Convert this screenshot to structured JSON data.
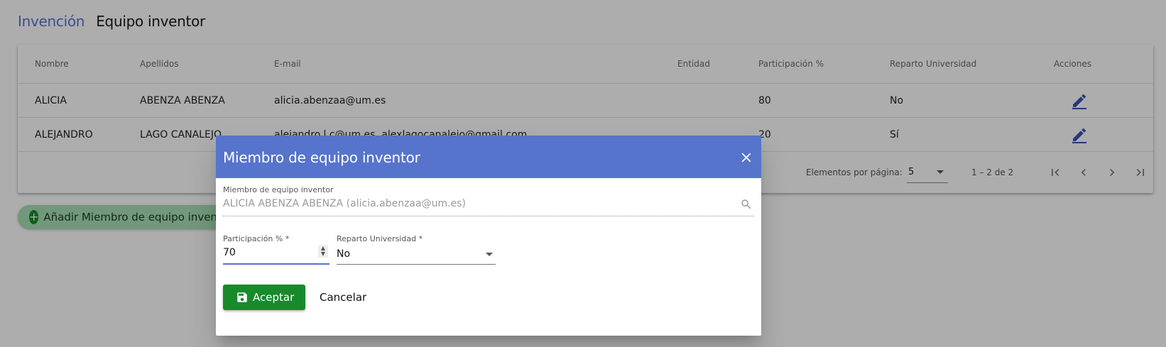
{
  "breadcrumb": {
    "parent": "Invención",
    "current": "Equipo inventor"
  },
  "table": {
    "headers": {
      "nombre": "Nombre",
      "apellidos": "Apellidos",
      "email": "E-mail",
      "entidad": "Entidad",
      "participacion": "Participación %",
      "reparto": "Reparto Universidad",
      "acciones": "Acciones"
    },
    "rows": [
      {
        "nombre": "ALICIA",
        "apellidos": "ABENZA ABENZA",
        "email": "alicia.abenzaa@um.es",
        "entidad": "",
        "participacion": "80",
        "reparto": "No"
      },
      {
        "nombre": "ALEJANDRO",
        "apellidos": "LAGO CANALEJO",
        "email": "alejandro.l.c@um.es, alexlagocanalejo@gmail.com",
        "entidad": "",
        "participacion": "20",
        "reparto": "Sí"
      }
    ]
  },
  "paginator": {
    "label": "Elementos por página:",
    "page_size": "5",
    "range": "1 – 2 de 2"
  },
  "add_button": {
    "label": "Añadir Miembro de equipo inventor"
  },
  "dialog": {
    "title": "Miembro de equipo inventor",
    "member": {
      "label": "Miembro de equipo inventor",
      "value": "ALICIA ABENZA ABENZA (alicia.abenzaa@um.es)"
    },
    "participation": {
      "label": "Participación % *",
      "value": "70"
    },
    "reparto": {
      "label": "Reparto Universidad *",
      "value": "No"
    },
    "accept_label": "Aceptar",
    "cancel_label": "Cancelar"
  },
  "colors": {
    "primary": "#5674cc",
    "success": "#178a2c",
    "breadcrumb_link": "#5c75cc"
  }
}
